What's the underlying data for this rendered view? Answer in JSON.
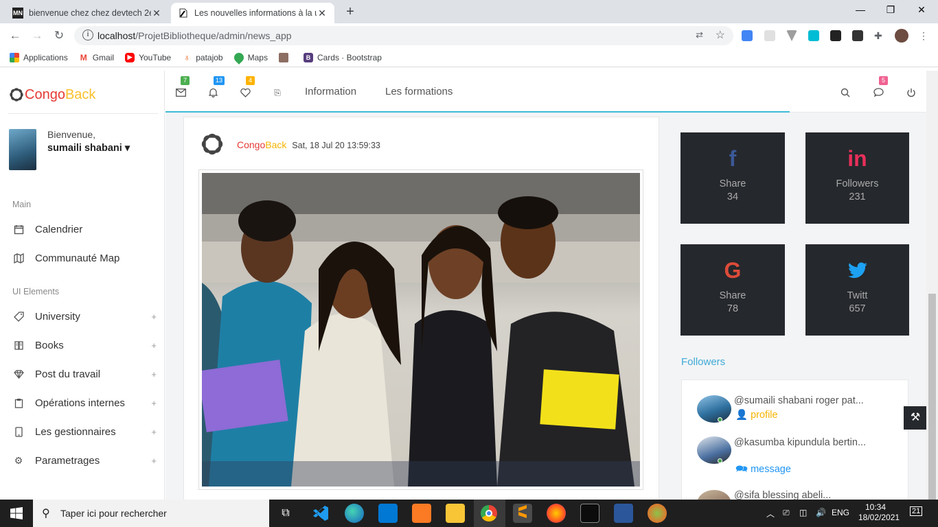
{
  "browser": {
    "tabs": [
      {
        "favicon": "MN",
        "title": "bienvenue chez chez devtech 2e...",
        "active": false
      },
      {
        "favicon": "doc-icon",
        "title": "Les nouvelles informations à la u",
        "active": true
      }
    ],
    "new_tab": "+",
    "url_host": "localhost",
    "url_path": "/ProjetBibliotheque/admin/news_app",
    "bookmarks": [
      {
        "label": "Applications",
        "icon": "apps-grid-icon",
        "color": "#ea4335"
      },
      {
        "label": "Gmail",
        "icon": "gmail-icon",
        "color": "#ea4335"
      },
      {
        "label": "YouTube",
        "icon": "youtube-icon",
        "color": "#ff0000"
      },
      {
        "label": "patajob",
        "icon": "patajob-icon",
        "color": "#e65100"
      },
      {
        "label": "Maps",
        "icon": "maps-icon",
        "color": "#34a853"
      },
      {
        "label": "",
        "icon": "bookmark-icon",
        "color": "#8d6e63"
      },
      {
        "label": "Cards · Bootstrap",
        "icon": "bootstrap-icon",
        "color": "#563d7c"
      }
    ]
  },
  "sidebar": {
    "logo": {
      "part1": "C",
      "part2": "ongo",
      "part3": "Back"
    },
    "welcome": "Bienvenue,",
    "username": "sumaili shabani ▾",
    "sections": [
      {
        "title": "Main",
        "items": [
          {
            "label": "Calendrier",
            "icon": "calendar-icon",
            "expandable": false
          },
          {
            "label": "Communauté Map",
            "icon": "map-icon",
            "expandable": false
          }
        ]
      },
      {
        "title": "UI Elements",
        "items": [
          {
            "label": "University",
            "icon": "tag-icon",
            "expandable": true
          },
          {
            "label": "Books",
            "icon": "book-icon",
            "expandable": true
          },
          {
            "label": "Post du travail",
            "icon": "diamond-icon",
            "expandable": true
          },
          {
            "label": "Opérations internes",
            "icon": "clipboard-icon",
            "expandable": true
          },
          {
            "label": "Les gestionnaires",
            "icon": "tablet-icon",
            "expandable": true
          },
          {
            "label": "Parametrages",
            "icon": "gear-icon",
            "expandable": true
          }
        ]
      }
    ],
    "plus": "+"
  },
  "topnav": {
    "mail_badge": "7",
    "bell_badge": "13",
    "heart_badge": "4",
    "links": [
      "Information",
      "Les formations"
    ],
    "chat_badge": "5",
    "badge_colors": {
      "mail": "#4caf50",
      "bell": "#2196f3",
      "heart": "#ffb300",
      "chat": "#f06292"
    }
  },
  "post": {
    "author_part1": "Congo",
    "author_part2": "Back",
    "date": "Sat, 18 Jul 20 13:59:33"
  },
  "social": [
    {
      "icon": "facebook-icon",
      "glyph": "f",
      "label": "Share",
      "value": "34",
      "color": "#3b5998"
    },
    {
      "icon": "linkedin-icon",
      "glyph": "in",
      "label": "Followers",
      "value": "231",
      "color": "#e8305a"
    },
    {
      "icon": "google-icon",
      "glyph": "G",
      "label": "Share",
      "value": "78",
      "color": "#dd4b39"
    },
    {
      "icon": "twitter-icon",
      "glyph": "🐦",
      "label": "Twitt",
      "value": "657",
      "color": "#1da1f2"
    }
  ],
  "followers": {
    "title": "Followers",
    "items": [
      {
        "name": "@sumaili shabani roger pat...",
        "link": "profile",
        "link_icon": "user-icon",
        "link_color": "#f4b400"
      },
      {
        "name": "@kasumba kipundula bertin...",
        "link": "message",
        "link_icon": "comments-icon",
        "link_color": "#2196f3"
      },
      {
        "name": "@sifa blessing abeli...",
        "link": "",
        "link_icon": "",
        "link_color": ""
      }
    ]
  },
  "taskbar": {
    "search_placeholder": "Taper ici pour rechercher",
    "lang": "ENG",
    "time": "10:34",
    "date": "18/02/2021",
    "notifications": "21"
  }
}
